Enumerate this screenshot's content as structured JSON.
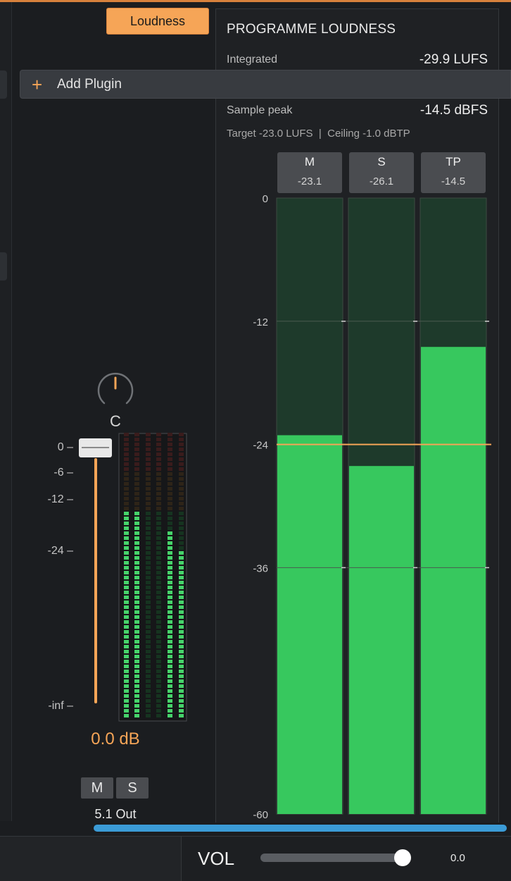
{
  "loudness_button": "Loudness",
  "add_plugin": {
    "icon": "plus-icon",
    "label": "Add Plugin"
  },
  "programme_loudness": {
    "title": "PROGRAMME LOUDNESS",
    "integrated_label": "Integrated",
    "integrated_value": "-29.9 LUFS",
    "sample_peak_label": "Sample peak",
    "sample_peak_value": "-14.5 dBFS",
    "target_text": "Target -23.0 LUFS  |  Ceiling -1.0 dBTP"
  },
  "meters": [
    {
      "name": "M",
      "value_label": "-23.1"
    },
    {
      "name": "S",
      "value_label": "-26.1"
    },
    {
      "name": "TP",
      "value_label": "-14.5"
    }
  ],
  "chart_data": {
    "type": "bar",
    "categories": [
      "M",
      "S",
      "TP"
    ],
    "values": [
      -23.1,
      -26.1,
      -14.5
    ],
    "ylim": [
      -60,
      0
    ],
    "ticks": [
      0,
      -12,
      -24,
      -36,
      -60
    ],
    "tick_labels": [
      "0",
      "-12",
      "-24",
      "-36",
      "-60"
    ],
    "target_line": -24,
    "colors": {
      "fill": "#37c85e",
      "empty": "#1e3a2b",
      "target": "#f6a557"
    }
  },
  "channel": {
    "pan_label": "C",
    "scale_labels": [
      "0 –",
      "-6 –",
      "-12 –",
      "-24 –",
      "-inf –"
    ],
    "gain_value": "0.0 dB",
    "mute_label": "M",
    "solo_label": "S",
    "output_label": "5.1 Out",
    "meter_levels": [
      0.73,
      0.73,
      0.0,
      0.0,
      0.65,
      0.59
    ]
  },
  "bottom": {
    "vol_label": "VOL",
    "vol_value": "0.0",
    "vol_level": 0.92
  },
  "colors": {
    "accent": "#f6a557",
    "meter_green": "#37c85e",
    "scroll_blue": "#3b9bd6"
  }
}
